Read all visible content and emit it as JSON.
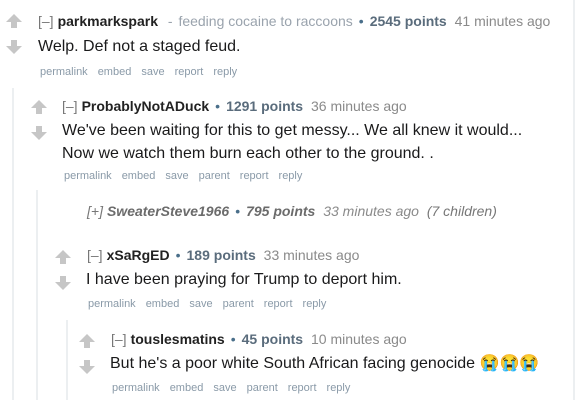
{
  "collapse_label": "[–]",
  "expand_label": "[+]",
  "separator_dot": "•",
  "separator_dash": "-",
  "buttons": {
    "permalink": "permalink",
    "embed": "embed",
    "save": "save",
    "parent": "parent",
    "report": "report",
    "reply": "reply"
  },
  "comments": [
    {
      "author": "parkmarkspark",
      "flair": "feeding cocaine to raccoons",
      "points": "2545 points",
      "time": "41 minutes ago",
      "body": "Welp. Def not a staged feud."
    },
    {
      "author": "ProbablyNotADuck",
      "points": "1291 points",
      "time": "36 minutes ago",
      "body": "We've been waiting for this to get messy... We all knew it would... Now we watch them burn each other to the ground. ."
    },
    {
      "author": "SweaterSteve1966",
      "points": "795 points",
      "time": "33 minutes ago",
      "children": "(7 children)"
    },
    {
      "author": "xSaRgED",
      "points": "189 points",
      "time": "33 minutes ago",
      "body": "I have been praying for Trump to deport him."
    },
    {
      "author": "touslesmatins",
      "points": "45 points",
      "time": "10 minutes ago",
      "body": "But he's a poor white South African facing genocide 😭😭😭"
    }
  ]
}
